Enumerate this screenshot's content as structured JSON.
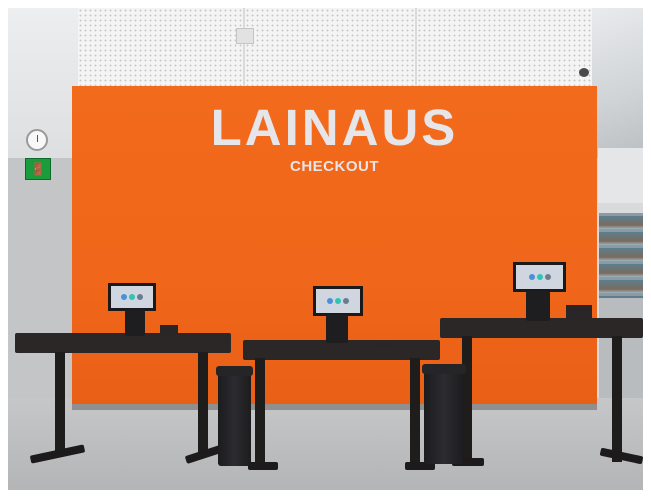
{
  "sign": {
    "title": "LAINAUS",
    "subtitle": "CHECKOUT"
  },
  "icons": {
    "exit": "emergency-exit-sign",
    "clock": "wall-clock"
  },
  "colors": {
    "wall_orange": "#F26A1B",
    "sign_text": "#E6E6EA",
    "desk": "#2B2727",
    "floor": "#BDBEBF",
    "screen_dot_1": "#4a90d9",
    "screen_dot_2": "#2ec4b6",
    "screen_dot_3": "#6b7c8f"
  }
}
